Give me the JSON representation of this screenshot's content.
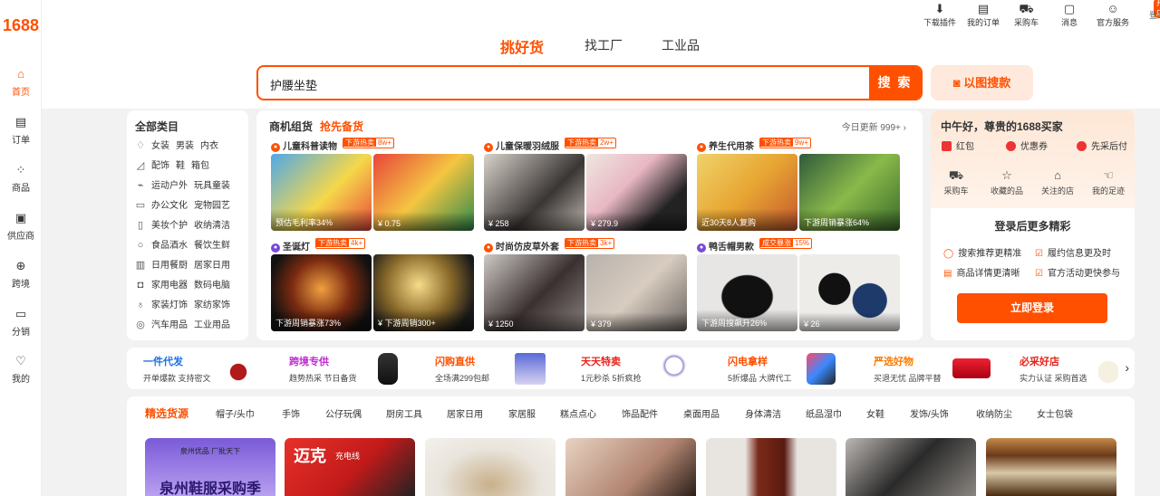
{
  "logo": "1688",
  "sidebar": [
    {
      "label": "首页",
      "icon": "home-icon"
    },
    {
      "label": "订单",
      "icon": "order-icon"
    },
    {
      "label": "商品",
      "icon": "grid-icon"
    },
    {
      "label": "供应商",
      "icon": "supplier-icon"
    },
    {
      "label": "跨境",
      "icon": "globe-icon"
    },
    {
      "label": "分销",
      "icon": "folder-icon"
    },
    {
      "label": "我的",
      "icon": "user-icon"
    }
  ],
  "toolbar": [
    {
      "label": "下载插件"
    },
    {
      "label": "我的订单"
    },
    {
      "label": "采购车"
    },
    {
      "label": "消息"
    },
    {
      "label": "官方服务"
    }
  ],
  "toolbar_extra": {
    "tag": "开店",
    "login": "登录"
  },
  "tabs": [
    "挑好货",
    "找工厂",
    "工业品"
  ],
  "search": {
    "query": "护腰坐垫",
    "button": "搜 索",
    "image_search": "以图搜款"
  },
  "categories": {
    "title": "全部类目",
    "rows": [
      [
        "女装",
        "男装",
        "内衣"
      ],
      [
        "配饰",
        "鞋",
        "箱包"
      ],
      [
        "运动户外",
        "玩具童装"
      ],
      [
        "办公文化",
        "宠物园艺"
      ],
      [
        "美妆个护",
        "收纳清洁"
      ],
      [
        "食品酒水",
        "餐饮生鲜"
      ],
      [
        "日用餐厨",
        "居家日用"
      ],
      [
        "家用电器",
        "数码电脑"
      ],
      [
        "家装灯饰",
        "家纺家饰"
      ],
      [
        "汽车用品",
        "工业用品"
      ]
    ]
  },
  "opportunity": {
    "title": "商机组货",
    "subtitle": "抢先备货",
    "updated": "今日更新 999+",
    "groups": [
      {
        "title": "儿童科普读物",
        "badge": "下游热卖",
        "count": "8w+",
        "labels": [
          "预估毛利率34%",
          "¥ 0.75"
        ]
      },
      {
        "title": "儿童保暖羽绒服",
        "badge": "下游热卖",
        "count": "2w+",
        "labels": [
          "¥ 258",
          "¥ 279.9"
        ]
      },
      {
        "title": "养生代用茶",
        "badge": "下游热卖",
        "count": "9w+",
        "labels": [
          "近30天8人复购",
          "下游周销暴涨64%"
        ]
      },
      {
        "title": "圣诞灯",
        "badge": "下游热卖",
        "count": "4k+",
        "labels": [
          "下游周销暴涨73%",
          "¥ 下游周销300+"
        ]
      },
      {
        "title": "时尚仿皮草外套",
        "badge": "下游热卖",
        "count": "3k+",
        "labels": [
          "¥ 1250",
          "¥ 379"
        ]
      },
      {
        "title": "鸭舌帽男款",
        "badge": "成交暴涨",
        "count": "15%",
        "labels": [
          "下游周搜飙升26%",
          "¥ 26"
        ]
      }
    ]
  },
  "right_panel": {
    "greeting": "中午好，尊贵的1688买家",
    "perks": [
      "红包",
      "优惠券",
      "先采后付"
    ],
    "quick": [
      "采购车",
      "收藏的品",
      "关注的店",
      "我的足迹"
    ],
    "login_title": "登录后更多精彩",
    "features": [
      "搜索推荐更精准",
      "履约信息更及时",
      "商品详情更清晰",
      "官方活动更快参与"
    ],
    "login_button": "立即登录"
  },
  "promos": [
    {
      "title": "一件代发",
      "sub": "开单爆款 支持密文"
    },
    {
      "title": "跨境专供",
      "sub": "趋势热采 节日备货"
    },
    {
      "title": "闪购直供",
      "sub": "全场满299包邮"
    },
    {
      "title": "天天特卖",
      "sub": "1元秒杀 5折疯抢"
    },
    {
      "title": "闪电拿样",
      "sub": "5折爆品 大牌代工"
    },
    {
      "title": "严选好物",
      "sub": "买退无忧 品牌平替"
    },
    {
      "title": "必采好店",
      "sub": "实力认证 采购首选"
    }
  ],
  "selection": {
    "title": "精选货源",
    "cats": [
      "帽子/头巾",
      "手饰",
      "公仔玩偶",
      "厨房工具",
      "居家日用",
      "家居服",
      "糕点点心",
      "饰品配件",
      "桌面用品",
      "身体清洁",
      "纸品湿巾",
      "女鞋",
      "发饰/头饰",
      "收纳防尘",
      "女士包袋"
    ],
    "banner_texts": [
      "泉州鞋服采购季",
      "泉州优品 厂批天下",
      "迈克",
      "充电线"
    ]
  },
  "colors": {
    "accent": "#ff5000",
    "promo_title_colors": [
      "#1a6fe0",
      "#c02bd0",
      "#ff5000",
      "#e8231a",
      "#ff5000",
      "#ff7a00",
      "#e8231a"
    ]
  }
}
